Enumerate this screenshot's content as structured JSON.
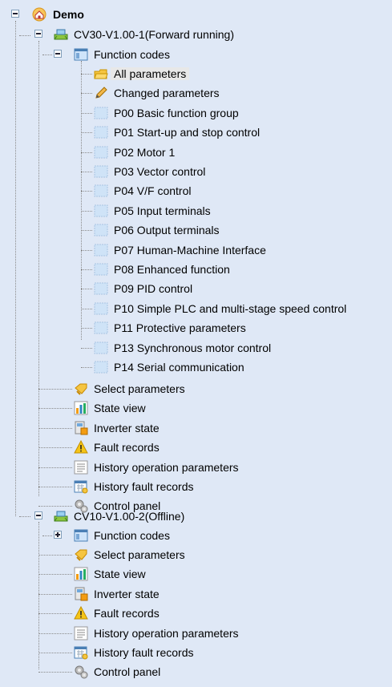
{
  "root": {
    "label": "Demo"
  },
  "devices": [
    {
      "label": "CV30-V1.00-1(Forward running)",
      "function_codes": "Function codes",
      "params": [
        "All parameters",
        "Changed parameters",
        "P00 Basic function group",
        "P01 Start-up and stop control",
        "P02 Motor 1",
        "P03 Vector control",
        "P04 V/F control",
        "P05 Input terminals",
        "P06 Output terminals",
        "P07 Human-Machine Interface",
        "P08 Enhanced function",
        "P09 PID control",
        "P10 Simple PLC and multi-stage speed control",
        "P11 Protective parameters",
        "P13 Synchronous motor control",
        "P14 Serial communication"
      ],
      "tools": [
        "Select parameters",
        "State view",
        "Inverter state",
        "Fault records",
        "History operation parameters",
        "History fault records",
        "Control panel"
      ]
    },
    {
      "label": "CV10-V1.00-2(Offline)",
      "function_codes": "Function codes",
      "tools": [
        "Select parameters",
        "State view",
        "Inverter state",
        "Fault records",
        "History operation parameters",
        "History fault records",
        "Control panel"
      ]
    }
  ],
  "selected": "All parameters",
  "colors": {
    "background": "#dfe8f6",
    "selection": "#e8e8e8",
    "tree_lines": "#8a8a8a"
  }
}
